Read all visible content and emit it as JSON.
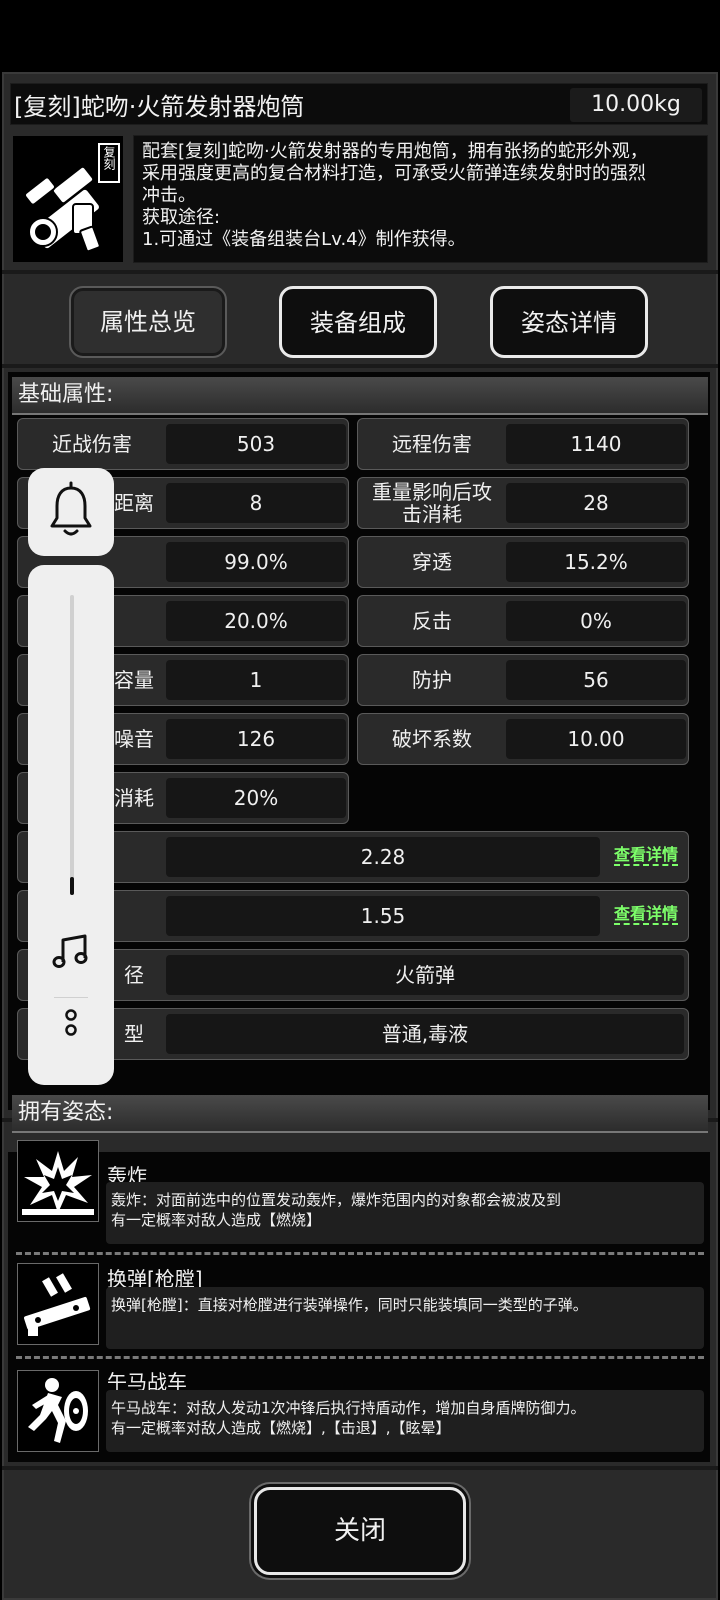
{
  "item": {
    "title": "[复刻]蛇吻·火箭发射器炮筒",
    "weight": "10.00kg",
    "icon_tag": "复刻",
    "description_lines": [
      "配套[复刻]蛇吻·火箭发射器的专用炮筒，拥有张扬的蛇形外观，",
      "采用强度更高的复合材料打造，可承受火箭弹连续发射时的强烈",
      "冲击。",
      "获取途径:",
      "1.可通过《装备组装台Lv.4》制作获得。"
    ]
  },
  "tabs": [
    {
      "label": "属性总览"
    },
    {
      "label": "装备组成"
    },
    {
      "label": "姿态详情"
    }
  ],
  "basic": {
    "heading": "基础属性:",
    "stats_left": [
      {
        "label": "近战伤害",
        "value": "503"
      },
      {
        "label": "距离",
        "value": "8"
      },
      {
        "label": "",
        "value": "99.0%"
      },
      {
        "label": "",
        "value": "20.0%"
      },
      {
        "label": "容量",
        "value": "1"
      },
      {
        "label": "噪音",
        "value": "126"
      },
      {
        "label": "消耗",
        "value": "20%"
      }
    ],
    "stats_right": [
      {
        "label": "远程伤害",
        "value": "1140"
      },
      {
        "label": "重量影响后攻击消耗",
        "value": "28"
      },
      {
        "label": "穿透",
        "value": "15.2%"
      },
      {
        "label": "反击",
        "value": "0%"
      },
      {
        "label": "防护",
        "value": "56"
      },
      {
        "label": "破坏系数",
        "value": "10.00"
      }
    ],
    "wide": [
      {
        "label": "",
        "value": "2.28",
        "link": "查看详情"
      },
      {
        "label": "",
        "value": "1.55",
        "link": "查看详情"
      },
      {
        "label": "径",
        "value": "火箭弹"
      },
      {
        "label": "型",
        "value": "普通,毒液"
      }
    ]
  },
  "postures": {
    "heading": "拥有姿态:",
    "items": [
      {
        "name": "轰炸",
        "icon": "explosion-icon",
        "desc": "轰炸：对面前选中的位置发动轰炸，爆炸范围内的对象都会被波及到\n有一定概率对敌人造成【燃烧】"
      },
      {
        "name": "换弹[枪膛]",
        "icon": "reload-icon",
        "desc": "换弹[枪膛]：直接对枪膛进行装弹操作，同时只能装填同一类型的子弹。"
      },
      {
        "name": "午马战车",
        "icon": "shield-charge-icon",
        "desc": "午马战车：对敌人发动1次冲锋后执行持盾动作，增加自身盾牌防御力。\n有一定概率对敌人造成【燃烧】,【击退】,【眩晕】"
      }
    ]
  },
  "floating_widget": {
    "volume_level": 0.06,
    "icons": [
      "bell-icon",
      "music-note-icon",
      "more-icon"
    ]
  },
  "close_label": "关闭"
}
